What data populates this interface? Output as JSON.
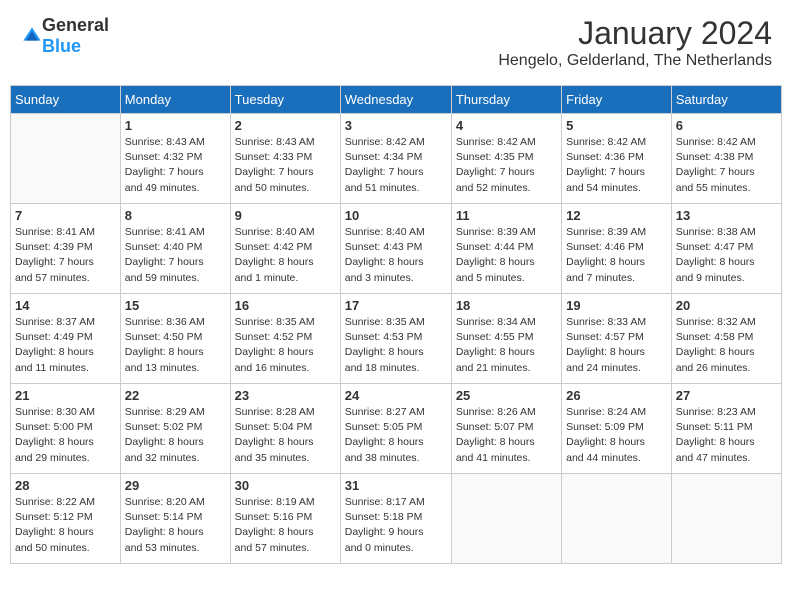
{
  "header": {
    "logo": {
      "general": "General",
      "blue": "Blue"
    },
    "title": "January 2024",
    "location": "Hengelo, Gelderland, The Netherlands"
  },
  "calendar": {
    "weekdays": [
      "Sunday",
      "Monday",
      "Tuesday",
      "Wednesday",
      "Thursday",
      "Friday",
      "Saturday"
    ],
    "weeks": [
      [
        {
          "day": "",
          "info": ""
        },
        {
          "day": "1",
          "info": "Sunrise: 8:43 AM\nSunset: 4:32 PM\nDaylight: 7 hours\nand 49 minutes."
        },
        {
          "day": "2",
          "info": "Sunrise: 8:43 AM\nSunset: 4:33 PM\nDaylight: 7 hours\nand 50 minutes."
        },
        {
          "day": "3",
          "info": "Sunrise: 8:42 AM\nSunset: 4:34 PM\nDaylight: 7 hours\nand 51 minutes."
        },
        {
          "day": "4",
          "info": "Sunrise: 8:42 AM\nSunset: 4:35 PM\nDaylight: 7 hours\nand 52 minutes."
        },
        {
          "day": "5",
          "info": "Sunrise: 8:42 AM\nSunset: 4:36 PM\nDaylight: 7 hours\nand 54 minutes."
        },
        {
          "day": "6",
          "info": "Sunrise: 8:42 AM\nSunset: 4:38 PM\nDaylight: 7 hours\nand 55 minutes."
        }
      ],
      [
        {
          "day": "7",
          "info": "Sunrise: 8:41 AM\nSunset: 4:39 PM\nDaylight: 7 hours\nand 57 minutes."
        },
        {
          "day": "8",
          "info": "Sunrise: 8:41 AM\nSunset: 4:40 PM\nDaylight: 7 hours\nand 59 minutes."
        },
        {
          "day": "9",
          "info": "Sunrise: 8:40 AM\nSunset: 4:42 PM\nDaylight: 8 hours\nand 1 minute."
        },
        {
          "day": "10",
          "info": "Sunrise: 8:40 AM\nSunset: 4:43 PM\nDaylight: 8 hours\nand 3 minutes."
        },
        {
          "day": "11",
          "info": "Sunrise: 8:39 AM\nSunset: 4:44 PM\nDaylight: 8 hours\nand 5 minutes."
        },
        {
          "day": "12",
          "info": "Sunrise: 8:39 AM\nSunset: 4:46 PM\nDaylight: 8 hours\nand 7 minutes."
        },
        {
          "day": "13",
          "info": "Sunrise: 8:38 AM\nSunset: 4:47 PM\nDaylight: 8 hours\nand 9 minutes."
        }
      ],
      [
        {
          "day": "14",
          "info": "Sunrise: 8:37 AM\nSunset: 4:49 PM\nDaylight: 8 hours\nand 11 minutes."
        },
        {
          "day": "15",
          "info": "Sunrise: 8:36 AM\nSunset: 4:50 PM\nDaylight: 8 hours\nand 13 minutes."
        },
        {
          "day": "16",
          "info": "Sunrise: 8:35 AM\nSunset: 4:52 PM\nDaylight: 8 hours\nand 16 minutes."
        },
        {
          "day": "17",
          "info": "Sunrise: 8:35 AM\nSunset: 4:53 PM\nDaylight: 8 hours\nand 18 minutes."
        },
        {
          "day": "18",
          "info": "Sunrise: 8:34 AM\nSunset: 4:55 PM\nDaylight: 8 hours\nand 21 minutes."
        },
        {
          "day": "19",
          "info": "Sunrise: 8:33 AM\nSunset: 4:57 PM\nDaylight: 8 hours\nand 24 minutes."
        },
        {
          "day": "20",
          "info": "Sunrise: 8:32 AM\nSunset: 4:58 PM\nDaylight: 8 hours\nand 26 minutes."
        }
      ],
      [
        {
          "day": "21",
          "info": "Sunrise: 8:30 AM\nSunset: 5:00 PM\nDaylight: 8 hours\nand 29 minutes."
        },
        {
          "day": "22",
          "info": "Sunrise: 8:29 AM\nSunset: 5:02 PM\nDaylight: 8 hours\nand 32 minutes."
        },
        {
          "day": "23",
          "info": "Sunrise: 8:28 AM\nSunset: 5:04 PM\nDaylight: 8 hours\nand 35 minutes."
        },
        {
          "day": "24",
          "info": "Sunrise: 8:27 AM\nSunset: 5:05 PM\nDaylight: 8 hours\nand 38 minutes."
        },
        {
          "day": "25",
          "info": "Sunrise: 8:26 AM\nSunset: 5:07 PM\nDaylight: 8 hours\nand 41 minutes."
        },
        {
          "day": "26",
          "info": "Sunrise: 8:24 AM\nSunset: 5:09 PM\nDaylight: 8 hours\nand 44 minutes."
        },
        {
          "day": "27",
          "info": "Sunrise: 8:23 AM\nSunset: 5:11 PM\nDaylight: 8 hours\nand 47 minutes."
        }
      ],
      [
        {
          "day": "28",
          "info": "Sunrise: 8:22 AM\nSunset: 5:12 PM\nDaylight: 8 hours\nand 50 minutes."
        },
        {
          "day": "29",
          "info": "Sunrise: 8:20 AM\nSunset: 5:14 PM\nDaylight: 8 hours\nand 53 minutes."
        },
        {
          "day": "30",
          "info": "Sunrise: 8:19 AM\nSunset: 5:16 PM\nDaylight: 8 hours\nand 57 minutes."
        },
        {
          "day": "31",
          "info": "Sunrise: 8:17 AM\nSunset: 5:18 PM\nDaylight: 9 hours\nand 0 minutes."
        },
        {
          "day": "",
          "info": ""
        },
        {
          "day": "",
          "info": ""
        },
        {
          "day": "",
          "info": ""
        }
      ]
    ]
  }
}
